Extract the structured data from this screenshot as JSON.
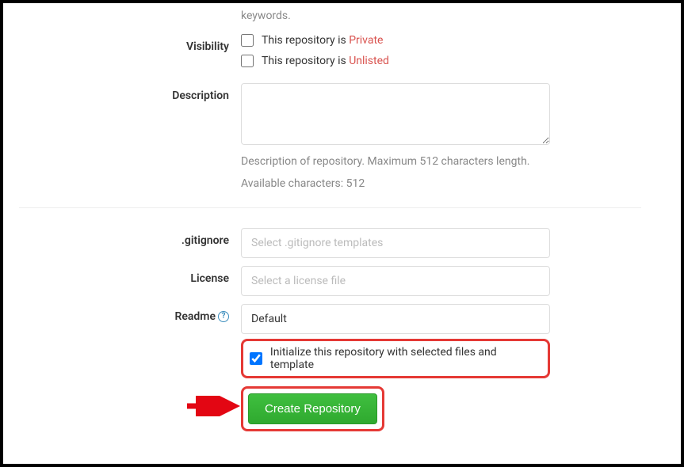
{
  "topHelp": "keywords.",
  "visibility": {
    "label": "Visibility",
    "private": {
      "prefix": "This repository is ",
      "state": "Private"
    },
    "unlisted": {
      "prefix": "This repository is ",
      "state": "Unlisted"
    }
  },
  "description": {
    "label": "Description",
    "help1": "Description of repository. Maximum 512 characters length.",
    "help2": "Available characters: 512"
  },
  "gitignore": {
    "label": ".gitignore",
    "placeholder": "Select .gitignore templates"
  },
  "license": {
    "label": "License",
    "placeholder": "Select a license file"
  },
  "readme": {
    "label": "Readme",
    "value": "Default",
    "initText": "Initialize this repository with selected files and template"
  },
  "createButton": "Create Repository"
}
